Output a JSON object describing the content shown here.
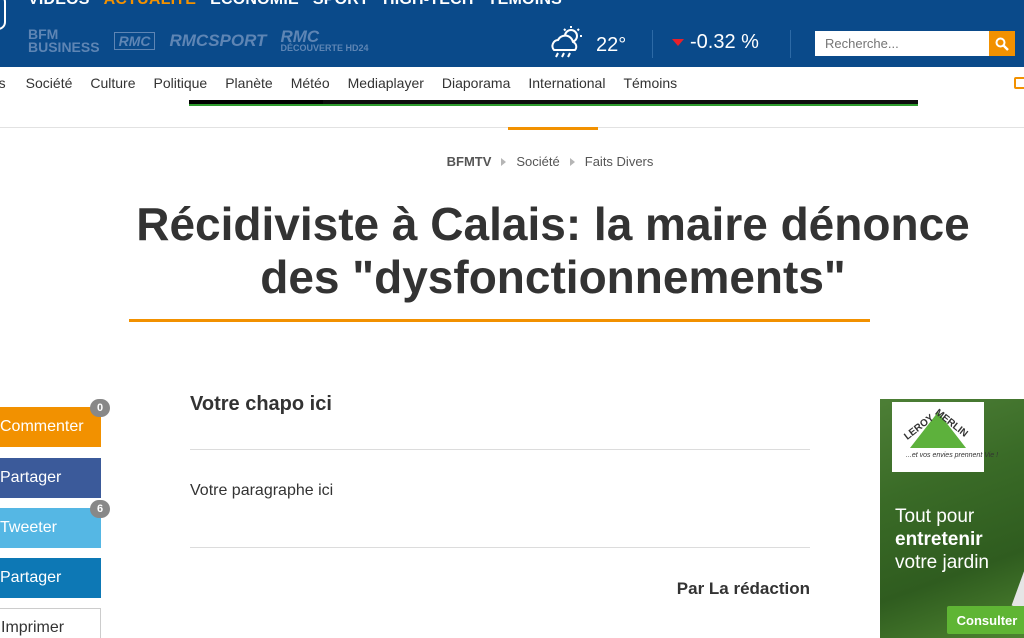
{
  "header": {
    "main_nav": [
      "VIDÉOS",
      "ACTUALITÉ",
      "ÉCONOMIE",
      "SPORT",
      "HIGH-TECH",
      "TÉMOINS"
    ],
    "active_index": 1,
    "brands": [
      "BFM BUSINESS",
      "RMC",
      "RMC SPORT",
      "RMC DÉCOUVERTE"
    ],
    "weather": {
      "temperature": "22°",
      "icon": "cloud-rain-sun-icon"
    },
    "market": {
      "value": "-0.32 %",
      "trend": "down"
    },
    "search": {
      "placeholder": "Recherche..."
    }
  },
  "subnav": {
    "items": [
      "rs",
      "Société",
      "Culture",
      "Politique",
      "Planète",
      "Météo",
      "Mediaplayer",
      "Diaporama",
      "International",
      "Témoins"
    ]
  },
  "breadcrumb": [
    "BFMTV",
    "Société",
    "Faits Divers"
  ],
  "article": {
    "title": "Récidiviste à Calais: la maire dénonce des \"dysfonctionnements\"",
    "chapo": "Votre chapo ici",
    "paragraph": "Votre paragraphe ici",
    "author": "Par La rédaction"
  },
  "share": {
    "comment": {
      "label": "Commenter",
      "count": "0"
    },
    "facebook": {
      "label": "Partager"
    },
    "twitter": {
      "label": "Tweeter",
      "count": "6"
    },
    "linkedin": {
      "label": "Partager"
    },
    "print": {
      "label": "Imprimer"
    }
  },
  "ad": {
    "brand": "LEROY MERLIN",
    "brand_part1": "LEROY",
    "brand_part2": "MERLIN",
    "tagline": "...et vos envies prennent Vie !",
    "line1": "Tout pour",
    "line2": "entretenir",
    "line3": "votre jardin",
    "cta": "Consulter"
  },
  "colors": {
    "header_blue": "#0a4a8a",
    "accent_orange": "#f29100",
    "facebook": "#3b5a9a",
    "twitter": "#55b7e4",
    "linkedin": "#0d78b5"
  }
}
